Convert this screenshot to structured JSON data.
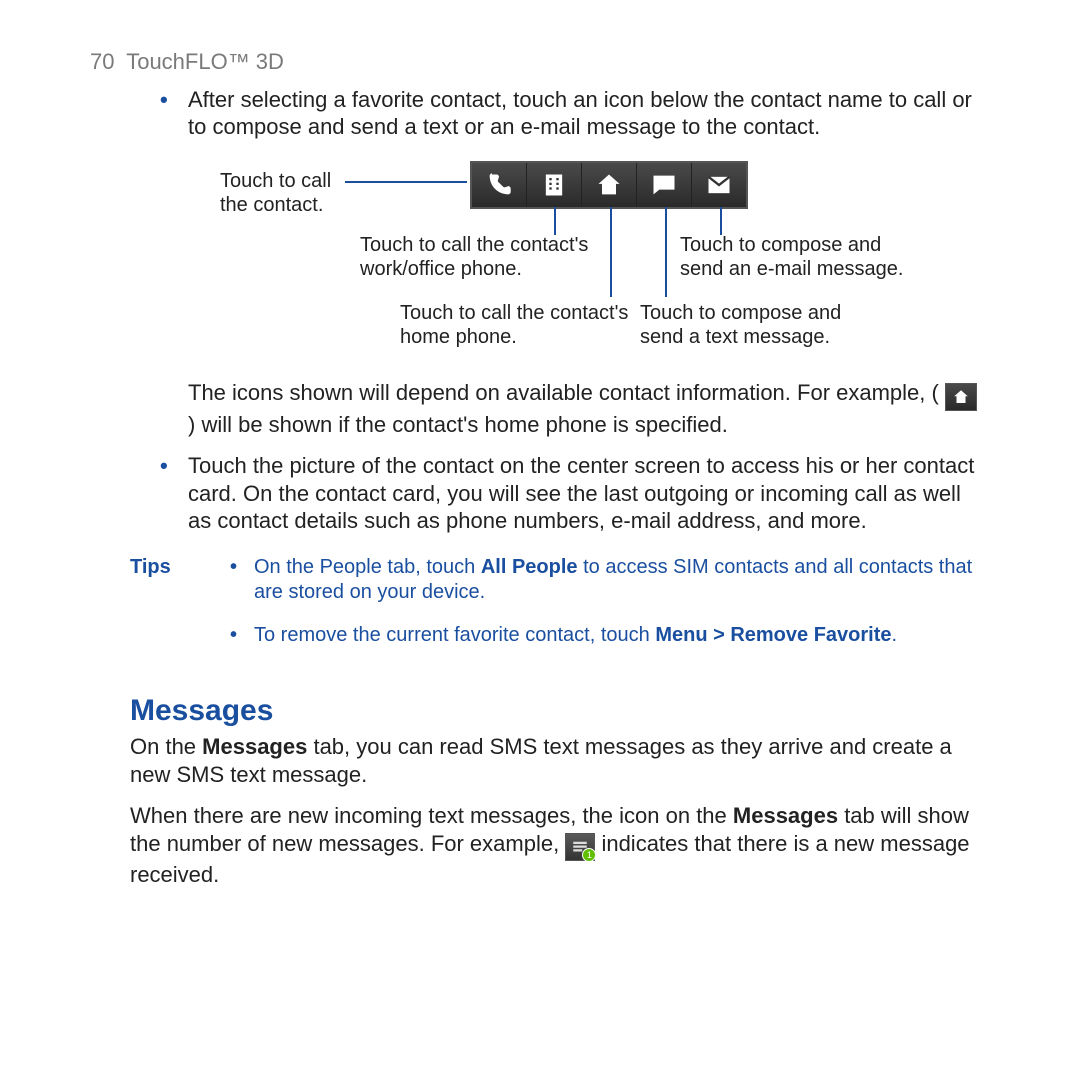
{
  "header": {
    "page_number": "70",
    "chapter": "TouchFLO™ 3D"
  },
  "bullet1": "After selecting a favorite contact, touch an icon below the contact name to call or to compose and send a text or an e-mail message to the contact.",
  "diagram": {
    "call_label_l1": "Touch to call",
    "call_label_l2": "the contact.",
    "work": "Touch to call the contact's work/office phone.",
    "email": "Touch to compose and send an e-mail message.",
    "home": "Touch to call the contact's home phone.",
    "sms": "Touch to compose and send a text message."
  },
  "note_before": "The icons shown will depend on available contact information. For example, ( ",
  "note_after": " ) will be shown if the contact's home phone is specified.",
  "bullet2": "Touch the picture of the contact on the center screen to access his or her contact card. On the contact card, you will see the last outgoing or incoming call as well as contact details such as phone numbers, e-mail address, and more.",
  "tips": {
    "label": "Tips",
    "t1a": "On the People tab, touch ",
    "t1b": "All People",
    "t1c": " to access SIM contacts and  all contacts that are stored on your device.",
    "t2a": "To remove the current favorite contact, touch ",
    "t2b": "Menu > Remove Favorite",
    "t2c": "."
  },
  "section_heading": "Messages",
  "msg_p1a": "On the ",
  "msg_p1b": "Messages",
  "msg_p1c": " tab, you can read SMS text messages as they arrive and create a new SMS text message.",
  "msg_p2a": "When there are new incoming text messages, the icon on the ",
  "msg_p2b": "Messages",
  "msg_p2c": " tab will show the number of new messages. For example, ",
  "msg_p2d": " indicates that there is a new message received.",
  "msg_badge": "1"
}
